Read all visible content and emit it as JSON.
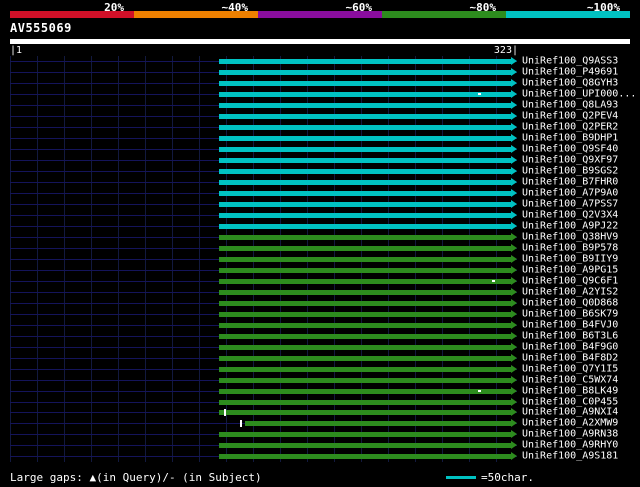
{
  "header": {
    "title": "AV555069"
  },
  "scale": {
    "segments": [
      {
        "label": "20%",
        "color": "#d01028"
      },
      {
        "label": "~40%",
        "color": "#ee8000"
      },
      {
        "label": "~60%",
        "color": "#8a0d9e"
      },
      {
        "label": "~80%",
        "color": "#2d8c1e"
      },
      {
        "label": "~100%",
        "color": "#00c2c2"
      }
    ]
  },
  "ruler": {
    "start_display": "|1",
    "end_display": "323|",
    "start": 1,
    "end": 323
  },
  "legend": {
    "gaps_text": "Large gaps: ▲(in Query)/- (in Subject)",
    "unit_label": "=50char.",
    "unit_color": "#00c2c2"
  },
  "chart_data": {
    "type": "bar",
    "orientation": "horizontal",
    "title": "AV555069",
    "query_length": 323,
    "x_range": [
      1,
      323
    ],
    "legend_bins": {
      "cyan": "~100% identity",
      "green": "~80% identity"
    },
    "colors": {
      "cyan": "#00c2c2",
      "green": "#2d8c1e"
    },
    "rows": [
      {
        "label": "UniRef100_Q9ASS3",
        "bin": "cyan",
        "start": 134,
        "end": 323
      },
      {
        "label": "UniRef100_P49691",
        "bin": "cyan",
        "start": 134,
        "end": 323
      },
      {
        "label": "UniRef100_Q8GYH3",
        "bin": "cyan",
        "start": 134,
        "end": 323
      },
      {
        "label": "UniRef100_UPI000...",
        "bin": "cyan",
        "start": 134,
        "end": 323,
        "marks": [
          {
            "pos": 298,
            "type": "dash"
          }
        ]
      },
      {
        "label": "UniRef100_Q8LA93",
        "bin": "cyan",
        "start": 134,
        "end": 323
      },
      {
        "label": "UniRef100_Q2PEV4",
        "bin": "cyan",
        "start": 134,
        "end": 323
      },
      {
        "label": "UniRef100_Q2PER2",
        "bin": "cyan",
        "start": 134,
        "end": 323
      },
      {
        "label": "UniRef100_B9DHP1",
        "bin": "cyan",
        "start": 134,
        "end": 323
      },
      {
        "label": "UniRef100_Q9SF40",
        "bin": "cyan",
        "start": 134,
        "end": 323
      },
      {
        "label": "UniRef100_Q9XF97",
        "bin": "cyan",
        "start": 134,
        "end": 323
      },
      {
        "label": "UniRef100_B9SGS2",
        "bin": "cyan",
        "start": 134,
        "end": 323
      },
      {
        "label": "UniRef100_B7FHR0",
        "bin": "cyan",
        "start": 134,
        "end": 323
      },
      {
        "label": "UniRef100_A7P9A0",
        "bin": "cyan",
        "start": 134,
        "end": 323
      },
      {
        "label": "UniRef100_A7PSS7",
        "bin": "cyan",
        "start": 134,
        "end": 323
      },
      {
        "label": "UniRef100_Q2V3X4",
        "bin": "cyan",
        "start": 134,
        "end": 323
      },
      {
        "label": "UniRef100_A9PJ22",
        "bin": "cyan",
        "start": 134,
        "end": 323
      },
      {
        "label": "UniRef100_Q38HV9",
        "bin": "green",
        "start": 134,
        "end": 323
      },
      {
        "label": "UniRef100_B9P578",
        "bin": "green",
        "start": 134,
        "end": 323
      },
      {
        "label": "UniRef100_B9IIY9",
        "bin": "green",
        "start": 134,
        "end": 323
      },
      {
        "label": "UniRef100_A9PG15",
        "bin": "green",
        "start": 134,
        "end": 323
      },
      {
        "label": "UniRef100_Q9C6F1",
        "bin": "green",
        "start": 134,
        "end": 323,
        "marks": [
          {
            "pos": 307,
            "type": "dash"
          }
        ]
      },
      {
        "label": "UniRef100_A2YIS2",
        "bin": "green",
        "start": 134,
        "end": 323
      },
      {
        "label": "UniRef100_Q0D868",
        "bin": "green",
        "start": 134,
        "end": 323
      },
      {
        "label": "UniRef100_B6SK79",
        "bin": "green",
        "start": 134,
        "end": 323
      },
      {
        "label": "UniRef100_B4FVJ0",
        "bin": "green",
        "start": 134,
        "end": 323
      },
      {
        "label": "UniRef100_B6T3L6",
        "bin": "green",
        "start": 134,
        "end": 323
      },
      {
        "label": "UniRef100_B4F9G0",
        "bin": "green",
        "start": 134,
        "end": 323
      },
      {
        "label": "UniRef100_B4F8D2",
        "bin": "green",
        "start": 134,
        "end": 323
      },
      {
        "label": "UniRef100_Q7Y1I5",
        "bin": "green",
        "start": 134,
        "end": 323
      },
      {
        "label": "UniRef100_C5WX74",
        "bin": "green",
        "start": 134,
        "end": 323
      },
      {
        "label": "UniRef100_B8LK49",
        "bin": "green",
        "start": 134,
        "end": 323,
        "marks": [
          {
            "pos": 298,
            "type": "dash"
          }
        ]
      },
      {
        "label": "UniRef100_C0P455",
        "bin": "green",
        "start": 134,
        "end": 323
      },
      {
        "label": "UniRef100_A9NXI4",
        "bin": "green",
        "start": 134,
        "end": 323,
        "marks": [
          {
            "pos": 137,
            "type": "tick"
          }
        ]
      },
      {
        "label": "UniRef100_A2XMW9",
        "bin": "green",
        "start": 150,
        "end": 323,
        "marks": [
          {
            "pos": 147,
            "type": "tick"
          }
        ]
      },
      {
        "label": "UniRef100_A9RN38",
        "bin": "green",
        "start": 134,
        "end": 323
      },
      {
        "label": "UniRef100_A9RHY0",
        "bin": "green",
        "start": 134,
        "end": 323
      },
      {
        "label": "UniRef100_A9S181",
        "bin": "green",
        "start": 134,
        "end": 323
      }
    ]
  }
}
